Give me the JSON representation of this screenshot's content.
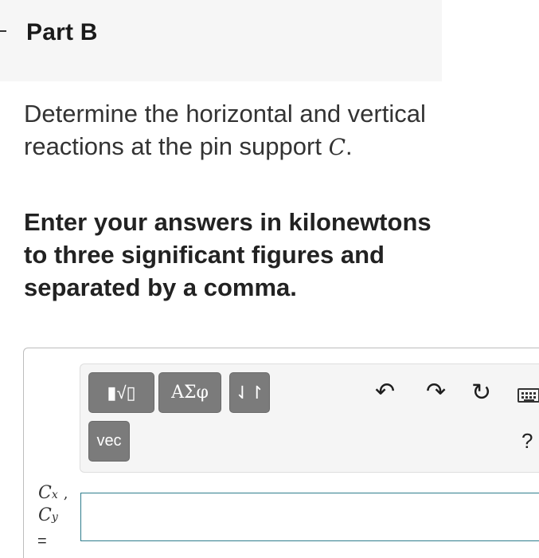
{
  "part": {
    "title": "Part B"
  },
  "question": {
    "text": "Determine the horizontal and vertical reactions at the pin support",
    "variable": "C",
    "end": "."
  },
  "instruction": "Enter your answers in kilonewtons to three significant figures and separated by a comma.",
  "toolbar": {
    "templates_label": "▮√▯",
    "greek_label": "ΑΣφ",
    "arrows_label": "⇃↾",
    "vec_label": "vec",
    "undo_icon": "undo-icon",
    "redo_icon": "redo-icon",
    "reset_icon": "reset-icon",
    "keyboard_icon": "keyboard-icon",
    "help_label": "?"
  },
  "answer": {
    "var1": "C",
    "var1_sub": "x",
    "separator": ",",
    "var2": "C",
    "var2_sub": "y",
    "equals": "=",
    "value": ""
  },
  "colors": {
    "input_border": "#2f7d8c",
    "button_bg": "#7b7b7b",
    "header_bg": "#f6f6f6"
  }
}
